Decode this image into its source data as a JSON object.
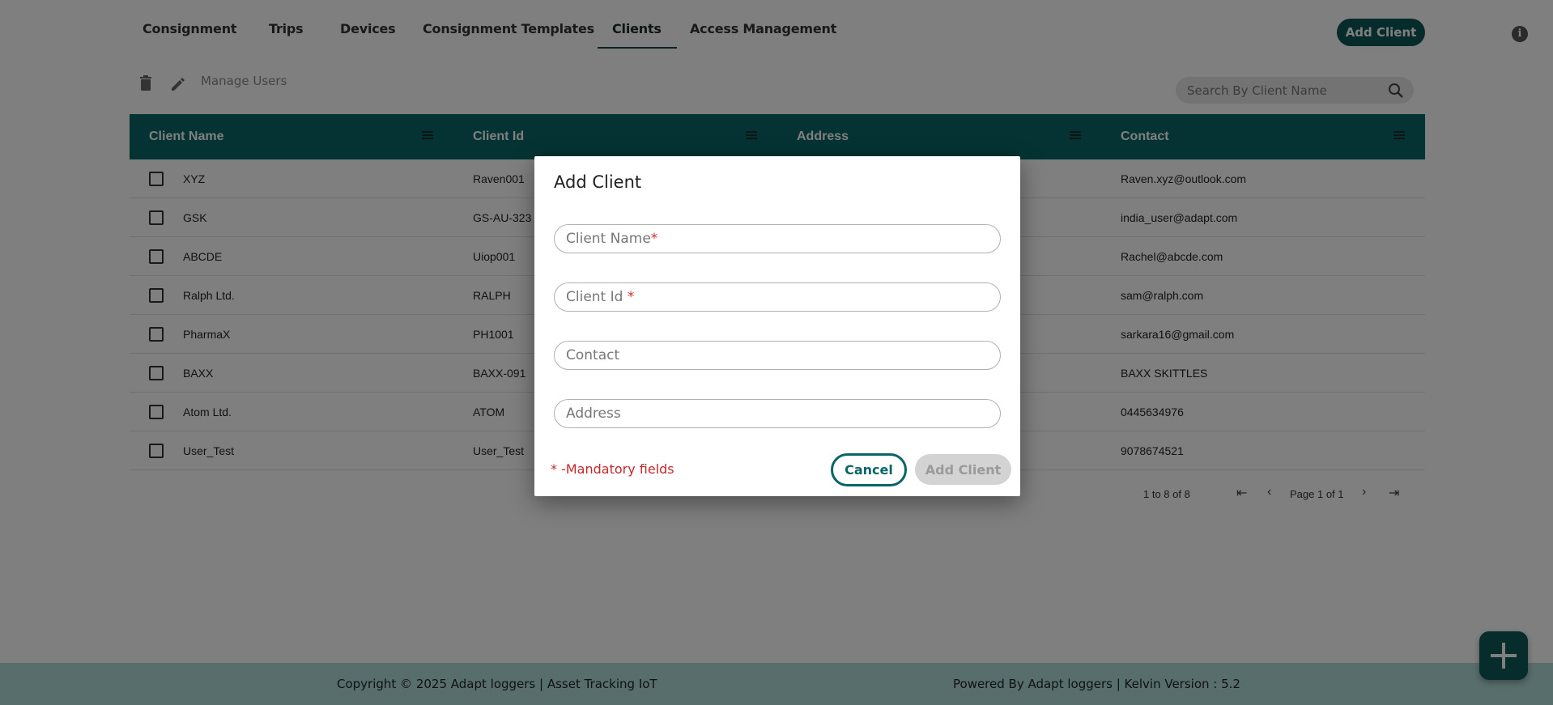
{
  "nav": {
    "tabs": [
      {
        "label": "Consignment"
      },
      {
        "label": "Trips"
      },
      {
        "label": "Devices"
      },
      {
        "label": "Consignment Templates"
      },
      {
        "label": "Clients"
      },
      {
        "label": "Access Management"
      }
    ],
    "active_tab": "Clients",
    "add_client_label": "Add Client",
    "info_glyph": "i"
  },
  "toolbar": {
    "delete_icon": "trash-icon",
    "edit_icon": "pencil-icon",
    "manage_users_label": "Manage Users",
    "search_placeholder": "Search By Client Name"
  },
  "table": {
    "columns": [
      "Client Name",
      "Client Id",
      "Address",
      "Contact"
    ],
    "rows": [
      {
        "name": "XYZ",
        "id": "Raven001",
        "address": "",
        "contact": "Raven.xyz@outlook.com"
      },
      {
        "name": "GSK",
        "id": "GS-AU-323",
        "address": "",
        "contact": "india_user@adapt.com"
      },
      {
        "name": "ABCDE",
        "id": "Uiop001",
        "address": "",
        "contact": "Rachel@abcde.com"
      },
      {
        "name": "Ralph Ltd.",
        "id": "RALPH",
        "address": "",
        "contact": "sam@ralph.com"
      },
      {
        "name": "PharmaX",
        "id": "PH1001",
        "address": "",
        "contact": "sarkara16@gmail.com"
      },
      {
        "name": "BAXX",
        "id": "BAXX-091",
        "address": "",
        "contact": "BAXX SKITTLES"
      },
      {
        "name": "Atom Ltd.",
        "id": "ATOM",
        "address": "",
        "contact": "0445634976"
      },
      {
        "name": "User_Test",
        "id": "User_Test",
        "address": "",
        "contact": "9078674521"
      }
    ],
    "pagination": {
      "range": "1 to 8 of 8",
      "page_info": "Page 1 of 1"
    }
  },
  "dialog": {
    "title": "Add Client",
    "fields": {
      "client_name": {
        "label": "Client Name",
        "required_mark": "*",
        "value": ""
      },
      "client_id": {
        "label": "Client Id ",
        "required_mark": "*",
        "value": ""
      },
      "contact": {
        "label": "Contact",
        "value": ""
      },
      "address": {
        "label": "Address",
        "value": ""
      }
    },
    "mandatory_note": "* -Mandatory fields",
    "cancel_label": "Cancel",
    "add_label": "Add Client"
  },
  "footer": {
    "copyright": "Copyright © 2025 Adapt loggers | Asset Tracking IoT",
    "powered_by": "Powered By Adapt loggers | Kelvin Version : 5.2"
  },
  "colors": {
    "brand": "#0a6666",
    "required": "#d32f2f",
    "footer_bg": "#b0dcd8"
  }
}
